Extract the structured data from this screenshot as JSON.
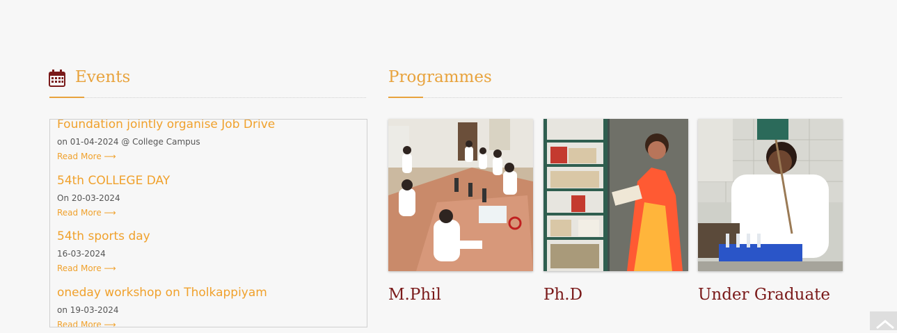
{
  "events": {
    "title": "Events",
    "icon": "calendar-icon",
    "items": [
      {
        "title": "Foundation jointly organise Job Drive",
        "date": "on 01-04-2024 @ College Campus",
        "more": "Read More ⟶"
      },
      {
        "title": "54th COLLEGE DAY",
        "date": "On 20-03-2024",
        "more": "Read More ⟶"
      },
      {
        "title": "54th sports day",
        "date": "16-03-2024",
        "more": "Read More ⟶"
      },
      {
        "title": "oneday workshop on Tholkappiyam",
        "date": "on 19-03-2024",
        "more": "Read More ⟶"
      }
    ]
  },
  "programmes": {
    "title": "Programmes",
    "cards": [
      {
        "label": "M.Phil"
      },
      {
        "label": "Ph.D"
      },
      {
        "label": "Under Graduate"
      }
    ]
  },
  "colors": {
    "accent": "#e8a33d",
    "card_label": "#7a1a1a",
    "background": "#f7f7f7"
  }
}
